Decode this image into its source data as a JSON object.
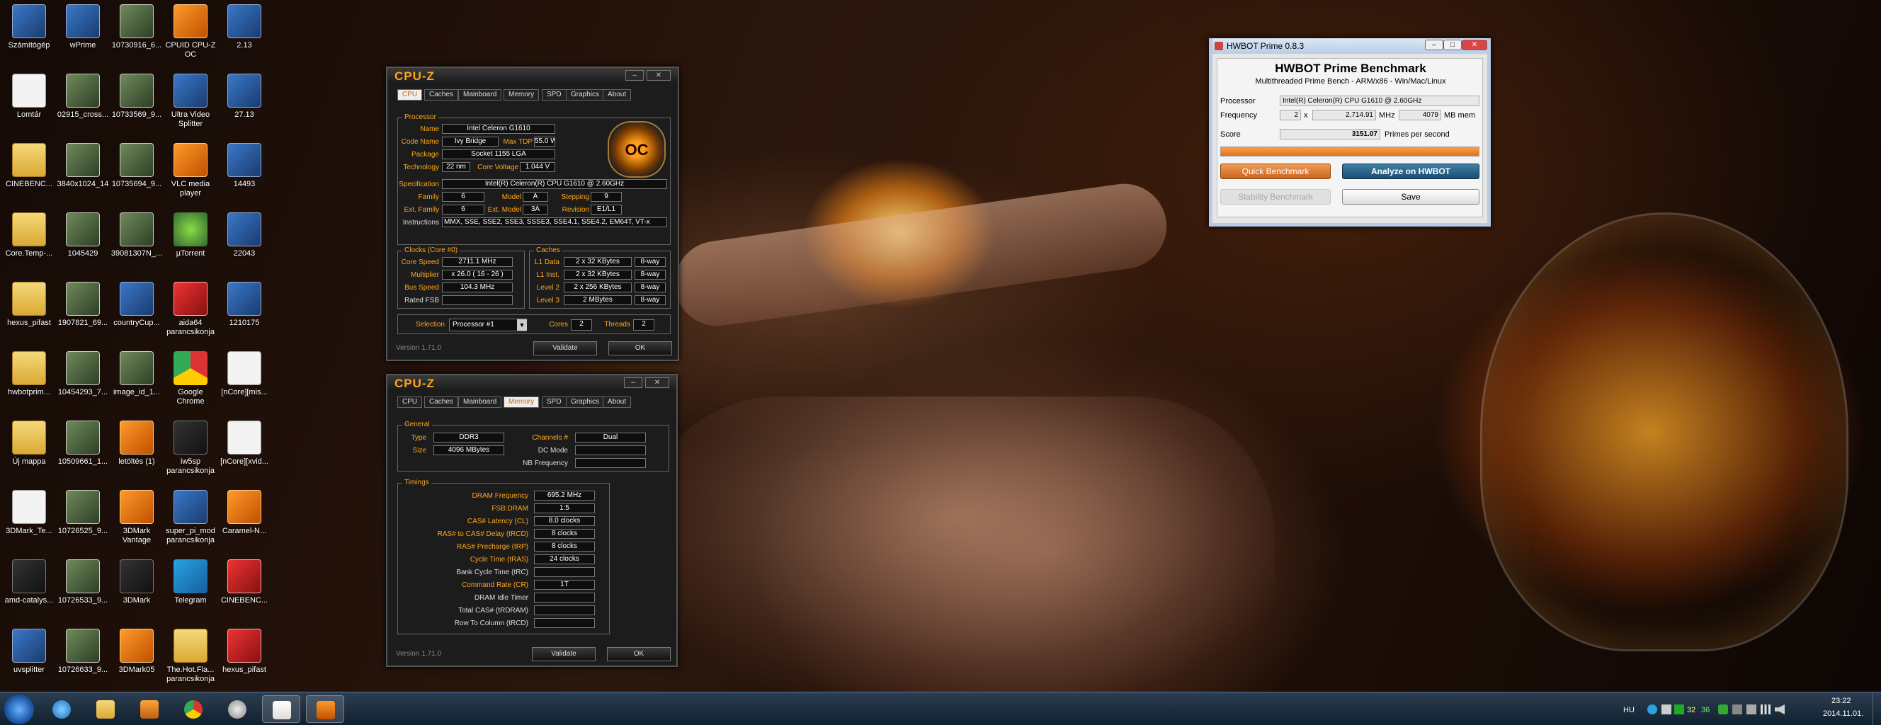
{
  "desktop_icons": [
    {
      "label": "Számítógép",
      "type": "g-app"
    },
    {
      "label": "Lomtár",
      "type": "g-doc"
    },
    {
      "label": "CINEBENC...",
      "type": "g-folder"
    },
    {
      "label": "Core.Temp-...",
      "type": "g-folder"
    },
    {
      "label": "hexus_pifast",
      "type": "g-folder"
    },
    {
      "label": "hwbotprim...",
      "type": "g-folder"
    },
    {
      "label": "Új mappa",
      "type": "g-folder"
    },
    {
      "label": "3DMark_Te...",
      "type": "g-doc"
    },
    {
      "label": "amd-catalys...",
      "type": "g-dark"
    },
    {
      "label": "uvsplitter",
      "type": "g-app"
    },
    {
      "label": "wPrime",
      "type": "g-app"
    },
    {
      "label": "02915_cross...",
      "type": "g-img"
    },
    {
      "label": "3840x1024_14",
      "type": "g-img"
    },
    {
      "label": "1045429",
      "type": "g-img"
    },
    {
      "label": "1907821_69...",
      "type": "g-img"
    },
    {
      "label": "10454293_7...",
      "type": "g-img"
    },
    {
      "label": "10509661_1...",
      "type": "g-img"
    },
    {
      "label": "10726525_9...",
      "type": "g-img"
    },
    {
      "label": "10726533_9...",
      "type": "g-img"
    },
    {
      "label": "10726633_9...",
      "type": "g-img"
    },
    {
      "label": "10730916_6...",
      "type": "g-img"
    },
    {
      "label": "10733569_9...",
      "type": "g-img"
    },
    {
      "label": "10735694_9...",
      "type": "g-img"
    },
    {
      "label": "39081307N_...",
      "type": "g-img"
    },
    {
      "label": "countryCup...",
      "type": "g-app"
    },
    {
      "label": "image_id_1...",
      "type": "g-img"
    },
    {
      "label": "letöltés (1)",
      "type": "g-orange"
    },
    {
      "label": "3DMark Vantage",
      "type": "g-orange"
    },
    {
      "label": "3DMark",
      "type": "g-dark"
    },
    {
      "label": "3DMark05",
      "type": "g-orange"
    },
    {
      "label": "CPUID CPU-Z OC",
      "type": "g-orange"
    },
    {
      "label": "Ultra Video Splitter",
      "type": "g-app"
    },
    {
      "label": "VLC media player",
      "type": "g-orange"
    },
    {
      "label": "µTorrent",
      "type": "g-green"
    },
    {
      "label": "aida64 parancsikonja",
      "type": "g-red"
    },
    {
      "label": "Google Chrome",
      "type": "g-chrome"
    },
    {
      "label": "iw5sp parancsikonja",
      "type": "g-dark"
    },
    {
      "label": "super_pi_mod parancsikonja",
      "type": "g-app"
    },
    {
      "label": "Telegram",
      "type": "g-blue"
    },
    {
      "label": "The.Hot.Fla... parancsikonja",
      "type": "g-folder"
    },
    {
      "label": "2.13",
      "type": "g-app"
    },
    {
      "label": "27.13",
      "type": "g-app"
    },
    {
      "label": "14493",
      "type": "g-app"
    },
    {
      "label": "22043",
      "type": "g-app"
    },
    {
      "label": "1210175",
      "type": "g-app"
    },
    {
      "label": "[nCore][mis...",
      "type": "g-doc"
    },
    {
      "label": "[nCore][xvid...",
      "type": "g-doc"
    },
    {
      "label": "Caramel-N...",
      "type": "g-orange"
    },
    {
      "label": "CINEBENC...",
      "type": "g-red"
    },
    {
      "label": "hexus_pifast",
      "type": "g-red"
    }
  ],
  "cpuz1": {
    "logo": "CPU-Z",
    "tabs": [
      "CPU",
      "Caches",
      "Mainboard",
      "Memory",
      "SPD",
      "Graphics",
      "About"
    ],
    "processor_legend": "Processor",
    "labels": {
      "name": "Name",
      "codename": "Code Name",
      "maxtdp": "Max TDP",
      "package": "Package",
      "technology": "Technology",
      "corevoltage": "Core Voltage",
      "specification": "Specification",
      "family": "Family",
      "model": "Model",
      "stepping": "Stepping",
      "extfamily": "Ext. Family",
      "extmodel": "Ext. Model",
      "revision": "Revision",
      "instructions": "Instructions"
    },
    "values": {
      "name": "Intel Celeron G1610",
      "codename": "Ivy Bridge",
      "maxtdp": "55.0 W",
      "package": "Socket 1155 LGA",
      "technology": "22 nm",
      "corevoltage": "1.044 V",
      "specification": "Intel(R) Celeron(R) CPU G1610 @ 2.60GHz",
      "family": "6",
      "model": "A",
      "stepping": "9",
      "extfamily": "6",
      "extmodel": "3A",
      "revision": "E1/L1",
      "instructions": "MMX, SSE, SSE2, SSE3, SSSE3, SSE4.1, SSE4.2, EM64T, VT-x"
    },
    "clocks_legend": "Clocks (Core #0)",
    "clock_labels": {
      "corespeed": "Core Speed",
      "multiplier": "Multiplier",
      "busspeed": "Bus Speed",
      "ratedfsb": "Rated FSB"
    },
    "clock_values": {
      "corespeed": "2711.1 MHz",
      "multiplier": "x 26.0 ( 16 - 26 )",
      "busspeed": "104.3 MHz",
      "ratedfsb": ""
    },
    "caches_legend": "Caches",
    "cache_rows": [
      {
        "label": "L1 Data",
        "size": "2 x 32 KBytes",
        "way": "8-way"
      },
      {
        "label": "L1 Inst.",
        "size": "2 x 32 KBytes",
        "way": "8-way"
      },
      {
        "label": "Level 2",
        "size": "2 x 256 KBytes",
        "way": "8-way"
      },
      {
        "label": "Level 3",
        "size": "2 MBytes",
        "way": "8-way"
      }
    ],
    "selection_label": "Selection",
    "selection_value": "Processor #1",
    "cores_label": "Cores",
    "cores_value": "2",
    "threads_label": "Threads",
    "threads_value": "2",
    "version": "Version 1.71.0",
    "validate": "Validate",
    "ok": "OK"
  },
  "cpuz2": {
    "logo": "CPU-Z",
    "tabs": [
      "CPU",
      "Caches",
      "Mainboard",
      "Memory",
      "SPD",
      "Graphics",
      "About"
    ],
    "general_legend": "General",
    "type_label": "Type",
    "type_value": "DDR3",
    "size_label": "Size",
    "size_value": "4096 MBytes",
    "channels_label": "Channels #",
    "channels_value": "Dual",
    "dcmode_label": "DC Mode",
    "dcmode_value": "",
    "nbfreq_label": "NB Frequency",
    "nbfreq_value": "",
    "timings_legend": "Timings",
    "timings": [
      {
        "label": "DRAM Frequency",
        "value": "695.2 MHz",
        "orange": true
      },
      {
        "label": "FSB:DRAM",
        "value": "1:5",
        "orange": true
      },
      {
        "label": "CAS# Latency (CL)",
        "value": "8.0 clocks",
        "orange": true
      },
      {
        "label": "RAS# to CAS# Delay (tRCD)",
        "value": "8 clocks",
        "orange": true
      },
      {
        "label": "RAS# Precharge (tRP)",
        "value": "8 clocks",
        "orange": true
      },
      {
        "label": "Cycle Time (tRAS)",
        "value": "24 clocks",
        "orange": true
      },
      {
        "label": "Bank Cycle Time (tRC)",
        "value": "",
        "orange": false
      },
      {
        "label": "Command Rate (CR)",
        "value": "1T",
        "orange": true
      },
      {
        "label": "DRAM Idle Timer",
        "value": "",
        "orange": false
      },
      {
        "label": "Total CAS# (tRDRAM)",
        "value": "",
        "orange": false
      },
      {
        "label": "Row To Column (tRCD)",
        "value": "",
        "orange": false
      }
    ],
    "version": "Version 1.71.0",
    "validate": "Validate",
    "ok": "OK"
  },
  "hwbot": {
    "title": "HWBOT Prime 0.8.3",
    "heading": "HWBOT Prime Benchmark",
    "subheading": "Multithreaded Prime Bench - ARM/x86 - Win/Mac/Linux",
    "processor_label": "Processor",
    "processor_value": "Intel(R) Celeron(R) CPU G1610 @ 2.60GHz",
    "frequency_label": "Frequency",
    "threads": "2",
    "x": "x",
    "freq": "2,714.91",
    "mhz": "MHz",
    "mem": "4079",
    "mbmem": "MB mem",
    "score_label": "Score",
    "score": "3151.07",
    "score_unit": "Primes per second",
    "progress": 1.0,
    "quick": "Quick Benchmark",
    "analyze": "Analyze on HWBOT",
    "stability": "Stability Benchmark",
    "save": "Save"
  },
  "taskbar": {
    "lang": "HU",
    "temp1": "32",
    "temp2": "36",
    "time": "23:22",
    "date": "2014.11.01."
  }
}
